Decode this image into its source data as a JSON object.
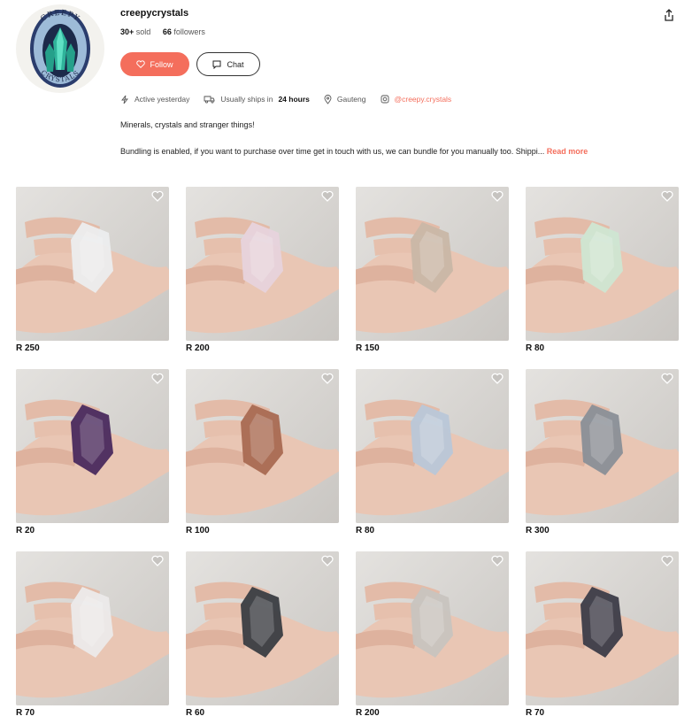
{
  "profile": {
    "username": "creepycrystals",
    "sold_count": "30+",
    "sold_label": "sold",
    "followers_count": "66",
    "followers_label": "followers",
    "follow_label": "Follow",
    "chat_label": "Chat",
    "avatar_text_top": "CREEPY",
    "avatar_text_bottom": "CRYSTALS"
  },
  "meta": {
    "active": "Active yesterday",
    "ships_prefix": "Usually ships in",
    "ships_value": "24 hours",
    "location": "Gauteng",
    "instagram": "@creepy.crystals"
  },
  "bio": {
    "line1": "Minerals, crystals and stranger things!",
    "line2": "Bundling is enabled, if you want to purchase over time get in touch with us, we can bundle for you manually too. Shippi...",
    "read_more": "Read more"
  },
  "colors": {
    "accent": "#f46e5c"
  },
  "items": [
    {
      "price": "R 250",
      "crystal": "#ecedee"
    },
    {
      "price": "R 200",
      "crystal": "#e7d3dc"
    },
    {
      "price": "R 150",
      "crystal": "#c9b7a6"
    },
    {
      "price": "R 80",
      "crystal": "#cfe6d2"
    },
    {
      "price": "R 20",
      "crystal": "#4a2a5e"
    },
    {
      "price": "R 100",
      "crystal": "#a96a52"
    },
    {
      "price": "R 80",
      "crystal": "#b9c7d8"
    },
    {
      "price": "R 300",
      "crystal": "#8a8f97"
    },
    {
      "price": "R 70",
      "crystal": "#eceaea"
    },
    {
      "price": "R 60",
      "crystal": "#3a3d42"
    },
    {
      "price": "R 200",
      "crystal": "#c8c4bf"
    },
    {
      "price": "R 70",
      "crystal": "#3c3c48"
    }
  ]
}
